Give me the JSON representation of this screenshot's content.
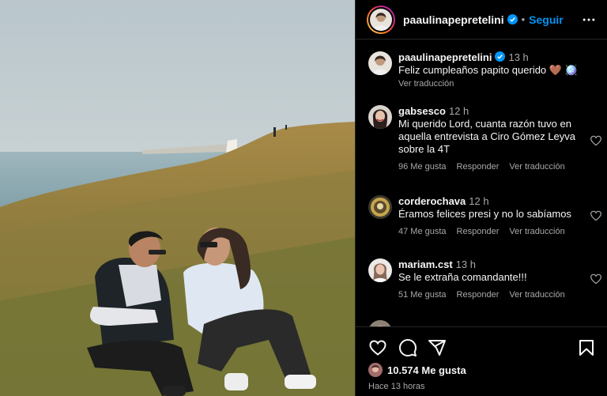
{
  "header": {
    "username": "paaulinapepretelini",
    "separator": "•",
    "follow_label": "Seguir"
  },
  "caption": {
    "username": "paaulinapepretelini",
    "time": "13 h",
    "text": "Feliz cumpleaños papito querido 🤎 🪩",
    "translate": "Ver traducción"
  },
  "comments": [
    {
      "username": "gabsesco",
      "time": "12 h",
      "text": "Mi querido Lord, cuanta razón tuvo en aquella entrevista a Ciro Gómez Leyva sobre la 4T",
      "likes": "96 Me gusta",
      "reply": "Responder",
      "translate": "Ver traducción"
    },
    {
      "username": "corderochava",
      "time": "12 h",
      "text": "Éramos felices presi y no lo sabíamos",
      "likes": "47 Me gusta",
      "reply": "Responder",
      "translate": "Ver traducción"
    },
    {
      "username": "mariam.cst",
      "time": "13 h",
      "text": "Se le extraña comandante!!!",
      "likes": "51 Me gusta",
      "reply": "Responder",
      "translate": "Ver traducción"
    }
  ],
  "post": {
    "likes": "10.574 Me gusta",
    "time_ago": "Hace 13 horas"
  },
  "colors": {
    "accent": "#0095f6",
    "background": "#000000",
    "secondary_text": "#a8a8a8"
  },
  "icons": [
    "verified-badge-icon",
    "more-options-icon",
    "heart-icon",
    "comment-icon",
    "share-icon",
    "bookmark-icon"
  ]
}
